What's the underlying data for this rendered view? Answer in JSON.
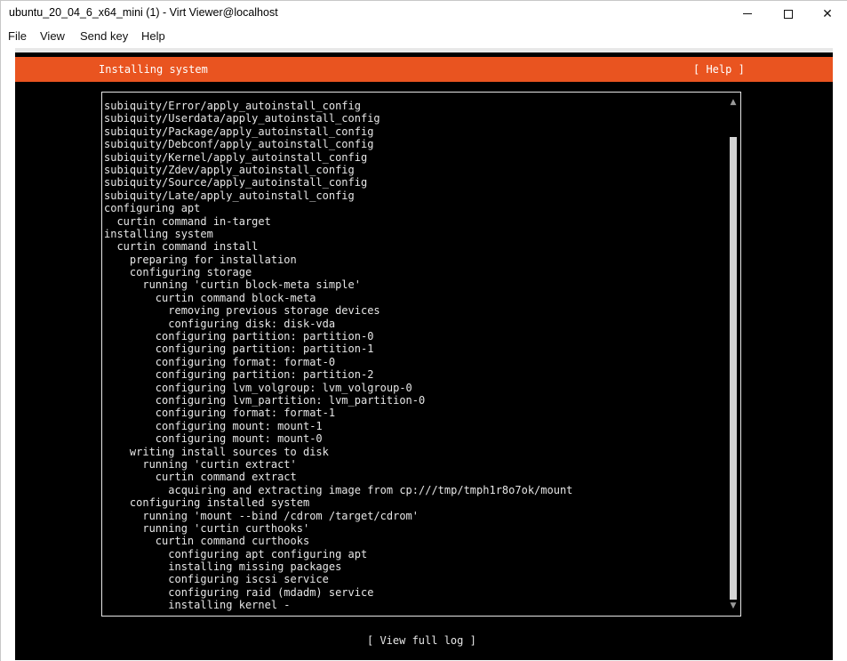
{
  "window": {
    "title": "ubuntu_20_04_6_x64_mini (1) - Virt Viewer@localhost",
    "controls": {
      "minimize": "minimize-icon",
      "maximize": "maximize-icon",
      "close": "close-icon",
      "close_glyph": "✕"
    }
  },
  "menu": {
    "items": [
      {
        "label": "File"
      },
      {
        "label": "View"
      },
      {
        "label": "Send key"
      },
      {
        "label": "Help"
      }
    ]
  },
  "installer": {
    "header_title": "Installing system",
    "help_label": "[ Help ]",
    "view_full_log_label": "[ View full log ]",
    "accent_color": "#e95420",
    "log_lines": [
      "subiquity/Error/apply_autoinstall_config",
      "subiquity/Userdata/apply_autoinstall_config",
      "subiquity/Package/apply_autoinstall_config",
      "subiquity/Debconf/apply_autoinstall_config",
      "subiquity/Kernel/apply_autoinstall_config",
      "subiquity/Zdev/apply_autoinstall_config",
      "subiquity/Source/apply_autoinstall_config",
      "subiquity/Late/apply_autoinstall_config",
      "configuring apt",
      "  curtin command in-target",
      "installing system",
      "  curtin command install",
      "    preparing for installation",
      "    configuring storage",
      "      running 'curtin block-meta simple'",
      "        curtin command block-meta",
      "          removing previous storage devices",
      "          configuring disk: disk-vda",
      "        configuring partition: partition-0",
      "        configuring partition: partition-1",
      "        configuring format: format-0",
      "        configuring partition: partition-2",
      "        configuring lvm_volgroup: lvm_volgroup-0",
      "        configuring lvm_partition: lvm_partition-0",
      "        configuring format: format-1",
      "        configuring mount: mount-1",
      "        configuring mount: mount-0",
      "    writing install sources to disk",
      "      running 'curtin extract'",
      "        curtin command extract",
      "          acquiring and extracting image from cp:///tmp/tmph1r8o7ok/mount",
      "    configuring installed system",
      "      running 'mount --bind /cdrom /target/cdrom'",
      "      running 'curtin curthooks'",
      "        curtin command curthooks",
      "          configuring apt configuring apt",
      "          installing missing packages",
      "          configuring iscsi service",
      "          configuring raid (mdadm) service",
      "          installing kernel -"
    ],
    "scrollbar": {
      "up_glyph": "▲",
      "down_glyph": "▼"
    }
  }
}
